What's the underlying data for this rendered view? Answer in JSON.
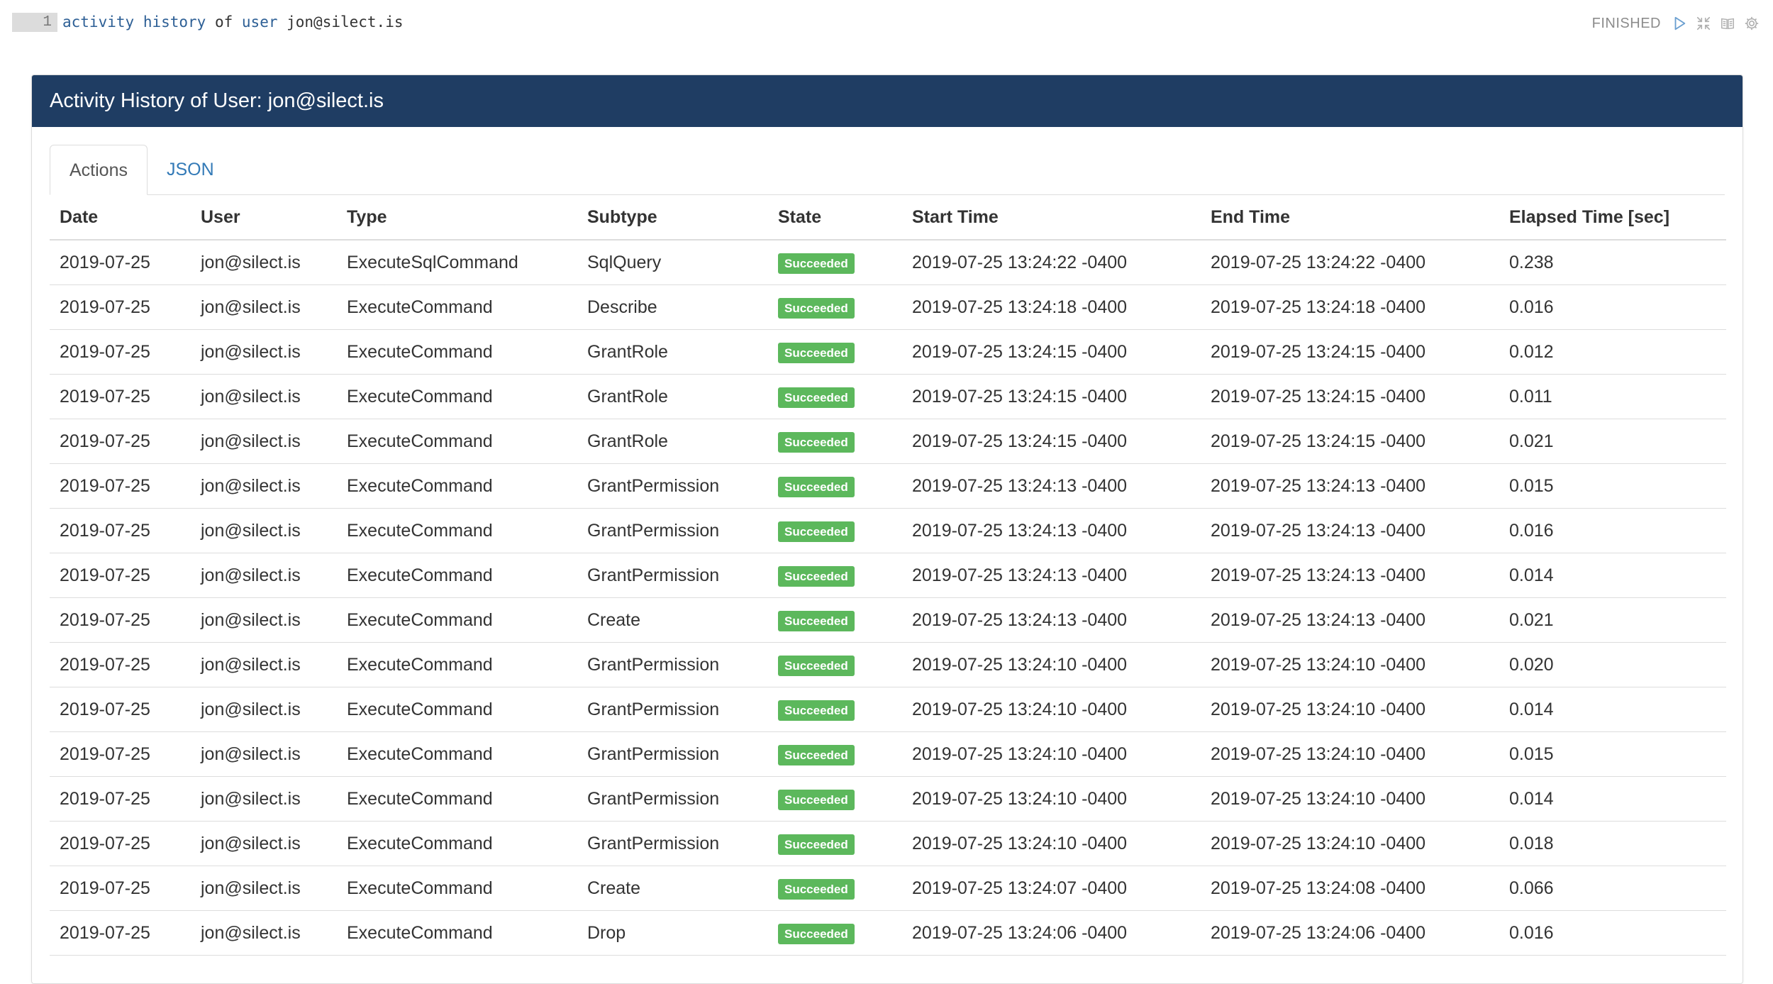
{
  "editor": {
    "line_number": "1",
    "code_tokens": [
      {
        "text": "activity",
        "kind": "kw"
      },
      {
        "text": " ",
        "kind": "plain"
      },
      {
        "text": "history",
        "kind": "kw"
      },
      {
        "text": " of ",
        "kind": "plain"
      },
      {
        "text": "user",
        "kind": "kw"
      },
      {
        "text": " jon@silect.is",
        "kind": "plain"
      }
    ],
    "status": "FINISHED",
    "toolbar_icons": [
      "run-icon",
      "hide-output-icon",
      "table-of-contents-icon",
      "settings-gear-icon"
    ]
  },
  "panel": {
    "title": "Activity History of User: jon@silect.is",
    "colors": {
      "header_bg": "#1f3d63",
      "badge_bg": "#5cb85c",
      "link": "#337ab7"
    },
    "tabs": [
      {
        "label": "Actions",
        "active": true
      },
      {
        "label": "JSON",
        "active": false
      }
    ],
    "columns": [
      "Date",
      "User",
      "Type",
      "Subtype",
      "State",
      "Start Time",
      "End Time",
      "Elapsed Time [sec]"
    ],
    "rows": [
      [
        "2019-07-25",
        "jon@silect.is",
        "ExecuteSqlCommand",
        "SqlQuery",
        "Succeeded",
        "2019-07-25 13:24:22 -0400",
        "2019-07-25 13:24:22 -0400",
        "0.238"
      ],
      [
        "2019-07-25",
        "jon@silect.is",
        "ExecuteCommand",
        "Describe",
        "Succeeded",
        "2019-07-25 13:24:18 -0400",
        "2019-07-25 13:24:18 -0400",
        "0.016"
      ],
      [
        "2019-07-25",
        "jon@silect.is",
        "ExecuteCommand",
        "GrantRole",
        "Succeeded",
        "2019-07-25 13:24:15 -0400",
        "2019-07-25 13:24:15 -0400",
        "0.012"
      ],
      [
        "2019-07-25",
        "jon@silect.is",
        "ExecuteCommand",
        "GrantRole",
        "Succeeded",
        "2019-07-25 13:24:15 -0400",
        "2019-07-25 13:24:15 -0400",
        "0.011"
      ],
      [
        "2019-07-25",
        "jon@silect.is",
        "ExecuteCommand",
        "GrantRole",
        "Succeeded",
        "2019-07-25 13:24:15 -0400",
        "2019-07-25 13:24:15 -0400",
        "0.021"
      ],
      [
        "2019-07-25",
        "jon@silect.is",
        "ExecuteCommand",
        "GrantPermission",
        "Succeeded",
        "2019-07-25 13:24:13 -0400",
        "2019-07-25 13:24:13 -0400",
        "0.015"
      ],
      [
        "2019-07-25",
        "jon@silect.is",
        "ExecuteCommand",
        "GrantPermission",
        "Succeeded",
        "2019-07-25 13:24:13 -0400",
        "2019-07-25 13:24:13 -0400",
        "0.016"
      ],
      [
        "2019-07-25",
        "jon@silect.is",
        "ExecuteCommand",
        "GrantPermission",
        "Succeeded",
        "2019-07-25 13:24:13 -0400",
        "2019-07-25 13:24:13 -0400",
        "0.014"
      ],
      [
        "2019-07-25",
        "jon@silect.is",
        "ExecuteCommand",
        "Create",
        "Succeeded",
        "2019-07-25 13:24:13 -0400",
        "2019-07-25 13:24:13 -0400",
        "0.021"
      ],
      [
        "2019-07-25",
        "jon@silect.is",
        "ExecuteCommand",
        "GrantPermission",
        "Succeeded",
        "2019-07-25 13:24:10 -0400",
        "2019-07-25 13:24:10 -0400",
        "0.020"
      ],
      [
        "2019-07-25",
        "jon@silect.is",
        "ExecuteCommand",
        "GrantPermission",
        "Succeeded",
        "2019-07-25 13:24:10 -0400",
        "2019-07-25 13:24:10 -0400",
        "0.014"
      ],
      [
        "2019-07-25",
        "jon@silect.is",
        "ExecuteCommand",
        "GrantPermission",
        "Succeeded",
        "2019-07-25 13:24:10 -0400",
        "2019-07-25 13:24:10 -0400",
        "0.015"
      ],
      [
        "2019-07-25",
        "jon@silect.is",
        "ExecuteCommand",
        "GrantPermission",
        "Succeeded",
        "2019-07-25 13:24:10 -0400",
        "2019-07-25 13:24:10 -0400",
        "0.014"
      ],
      [
        "2019-07-25",
        "jon@silect.is",
        "ExecuteCommand",
        "GrantPermission",
        "Succeeded",
        "2019-07-25 13:24:10 -0400",
        "2019-07-25 13:24:10 -0400",
        "0.018"
      ],
      [
        "2019-07-25",
        "jon@silect.is",
        "ExecuteCommand",
        "Create",
        "Succeeded",
        "2019-07-25 13:24:07 -0400",
        "2019-07-25 13:24:08 -0400",
        "0.066"
      ],
      [
        "2019-07-25",
        "jon@silect.is",
        "ExecuteCommand",
        "Drop",
        "Succeeded",
        "2019-07-25 13:24:06 -0400",
        "2019-07-25 13:24:06 -0400",
        "0.016"
      ]
    ]
  }
}
